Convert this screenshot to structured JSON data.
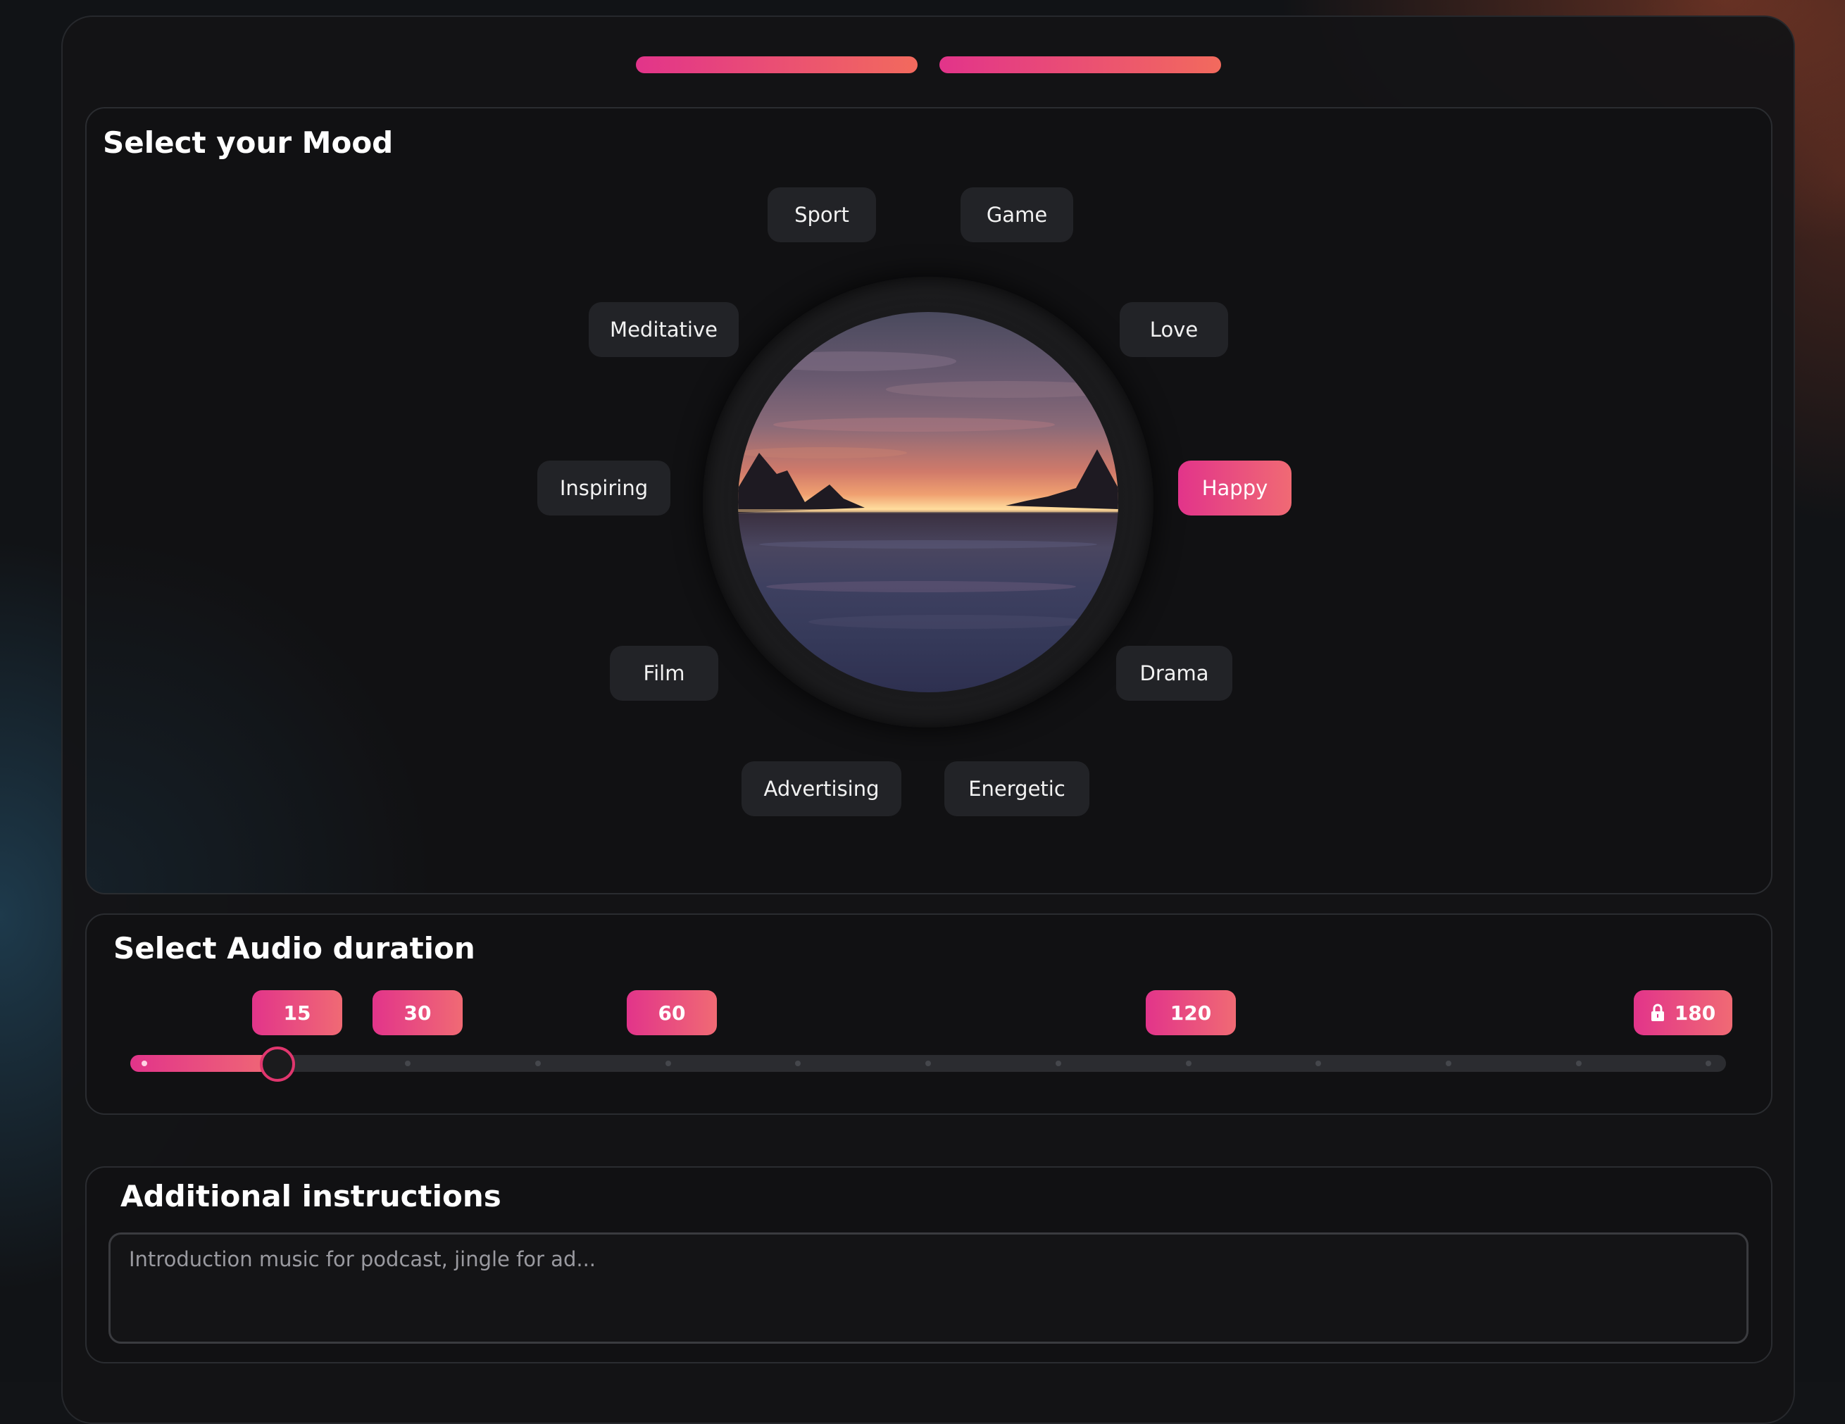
{
  "progress": {
    "steps": [
      {
        "label": "",
        "complete": true
      },
      {
        "label": "",
        "complete": true
      }
    ]
  },
  "mood": {
    "title": "Select your Mood",
    "selected": "Happy",
    "chips": {
      "sport": "Sport",
      "game": "Game",
      "meditative": "Meditative",
      "love": "Love",
      "inspiring": "Inspiring",
      "happy": "Happy",
      "film": "Film",
      "drama": "Drama",
      "advertising": "Advertising",
      "energetic": "Energetic"
    }
  },
  "duration": {
    "title": "Select Audio duration",
    "options": {
      "d15": "15",
      "d30": "30",
      "d60": "60",
      "d120": "120",
      "d180": "180"
    },
    "locked_option": "180",
    "selected_value": 15
  },
  "instructions": {
    "title": "Additional instructions",
    "placeholder": "Introduction music for podcast, jingle for ad...",
    "value": ""
  },
  "colors": {
    "accent_start": "#e2348a",
    "accent_end": "#f26a5d",
    "chip_bg": "#222327"
  }
}
